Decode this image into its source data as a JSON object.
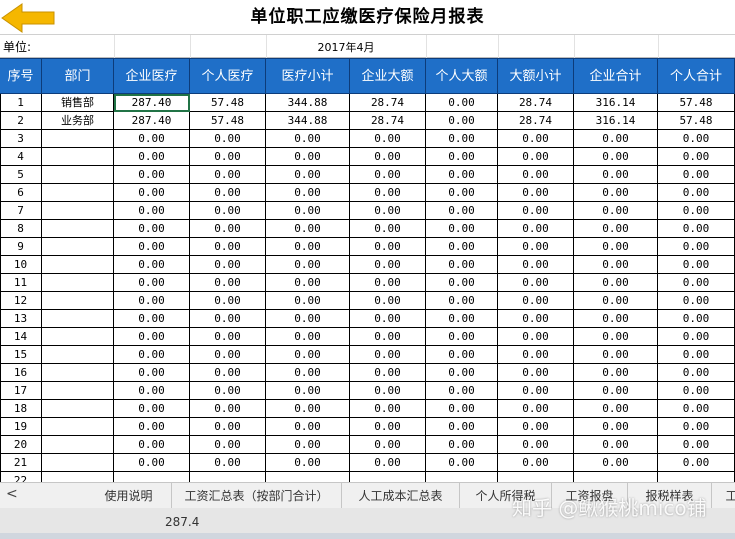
{
  "title": "单位职工应缴医疗保险月报表",
  "unit_label": "单位:",
  "report_date": "2017年4月",
  "columns": [
    "序号",
    "部门",
    "企业医疗",
    "个人医疗",
    "医疗小计",
    "企业大额",
    "个人大额",
    "大额小计",
    "企业合计",
    "个人合计"
  ],
  "rows": [
    [
      "1",
      "销售部",
      "287.40",
      "57.48",
      "344.88",
      "28.74",
      "0.00",
      "28.74",
      "316.14",
      "57.48"
    ],
    [
      "2",
      "业务部",
      "287.40",
      "57.48",
      "344.88",
      "28.74",
      "0.00",
      "28.74",
      "316.14",
      "57.48"
    ],
    [
      "3",
      "",
      "0.00",
      "0.00",
      "0.00",
      "0.00",
      "0.00",
      "0.00",
      "0.00",
      "0.00"
    ],
    [
      "4",
      "",
      "0.00",
      "0.00",
      "0.00",
      "0.00",
      "0.00",
      "0.00",
      "0.00",
      "0.00"
    ],
    [
      "5",
      "",
      "0.00",
      "0.00",
      "0.00",
      "0.00",
      "0.00",
      "0.00",
      "0.00",
      "0.00"
    ],
    [
      "6",
      "",
      "0.00",
      "0.00",
      "0.00",
      "0.00",
      "0.00",
      "0.00",
      "0.00",
      "0.00"
    ],
    [
      "7",
      "",
      "0.00",
      "0.00",
      "0.00",
      "0.00",
      "0.00",
      "0.00",
      "0.00",
      "0.00"
    ],
    [
      "8",
      "",
      "0.00",
      "0.00",
      "0.00",
      "0.00",
      "0.00",
      "0.00",
      "0.00",
      "0.00"
    ],
    [
      "9",
      "",
      "0.00",
      "0.00",
      "0.00",
      "0.00",
      "0.00",
      "0.00",
      "0.00",
      "0.00"
    ],
    [
      "10",
      "",
      "0.00",
      "0.00",
      "0.00",
      "0.00",
      "0.00",
      "0.00",
      "0.00",
      "0.00"
    ],
    [
      "11",
      "",
      "0.00",
      "0.00",
      "0.00",
      "0.00",
      "0.00",
      "0.00",
      "0.00",
      "0.00"
    ],
    [
      "12",
      "",
      "0.00",
      "0.00",
      "0.00",
      "0.00",
      "0.00",
      "0.00",
      "0.00",
      "0.00"
    ],
    [
      "13",
      "",
      "0.00",
      "0.00",
      "0.00",
      "0.00",
      "0.00",
      "0.00",
      "0.00",
      "0.00"
    ],
    [
      "14",
      "",
      "0.00",
      "0.00",
      "0.00",
      "0.00",
      "0.00",
      "0.00",
      "0.00",
      "0.00"
    ],
    [
      "15",
      "",
      "0.00",
      "0.00",
      "0.00",
      "0.00",
      "0.00",
      "0.00",
      "0.00",
      "0.00"
    ],
    [
      "16",
      "",
      "0.00",
      "0.00",
      "0.00",
      "0.00",
      "0.00",
      "0.00",
      "0.00",
      "0.00"
    ],
    [
      "17",
      "",
      "0.00",
      "0.00",
      "0.00",
      "0.00",
      "0.00",
      "0.00",
      "0.00",
      "0.00"
    ],
    [
      "18",
      "",
      "0.00",
      "0.00",
      "0.00",
      "0.00",
      "0.00",
      "0.00",
      "0.00",
      "0.00"
    ],
    [
      "19",
      "",
      "0.00",
      "0.00",
      "0.00",
      "0.00",
      "0.00",
      "0.00",
      "0.00",
      "0.00"
    ],
    [
      "20",
      "",
      "0.00",
      "0.00",
      "0.00",
      "0.00",
      "0.00",
      "0.00",
      "0.00",
      "0.00"
    ],
    [
      "21",
      "",
      "0.00",
      "0.00",
      "0.00",
      "0.00",
      "0.00",
      "0.00",
      "0.00",
      "0.00"
    ],
    [
      "22",
      "",
      "",
      "",
      "",
      "",
      "",
      "",
      "",
      ""
    ]
  ],
  "selected_cell": {
    "row": 0,
    "col": 2
  },
  "sheet_tabs": [
    "使用说明",
    "工资汇总表（按部门合计）",
    "人工成本汇总表",
    "个人所得税",
    "工资报盘",
    "报税样表",
    "工"
  ],
  "nav_arrow": "<",
  "status_value": "287.4",
  "watermark": "知乎 @鳅猴桃mico铺",
  "icons": {
    "back": "back-arrow-icon"
  },
  "colors": {
    "header_bg": "#1f6fc8",
    "header_text": "#ffffff",
    "selection": "#217346",
    "arrow": "#f5b700"
  }
}
